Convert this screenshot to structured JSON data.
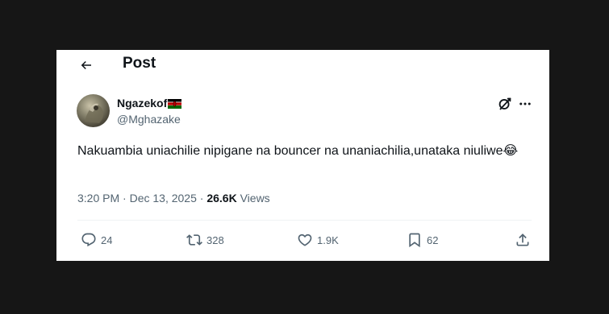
{
  "header": {
    "title": "Post",
    "back_icon": "arrow-left-icon"
  },
  "tweet": {
    "display_name": "Ngazekof",
    "name_emoji": "kenya-flag-icon",
    "handle": "@Mghazake",
    "text": "Nakuambia uniachilie nipigane na bouncer na unaniachilia,unataka niuliwe😂",
    "time": "3:20 PM",
    "date": "Dec 13, 2025",
    "views_count": "26.6K",
    "views_label": "Views"
  },
  "actions": {
    "replies": "24",
    "reposts": "328",
    "likes": "1.9K",
    "bookmarks": "62"
  },
  "colors": {
    "background": "#161616",
    "card": "#ffffff",
    "text": "#0f1419",
    "muted": "#536471"
  }
}
